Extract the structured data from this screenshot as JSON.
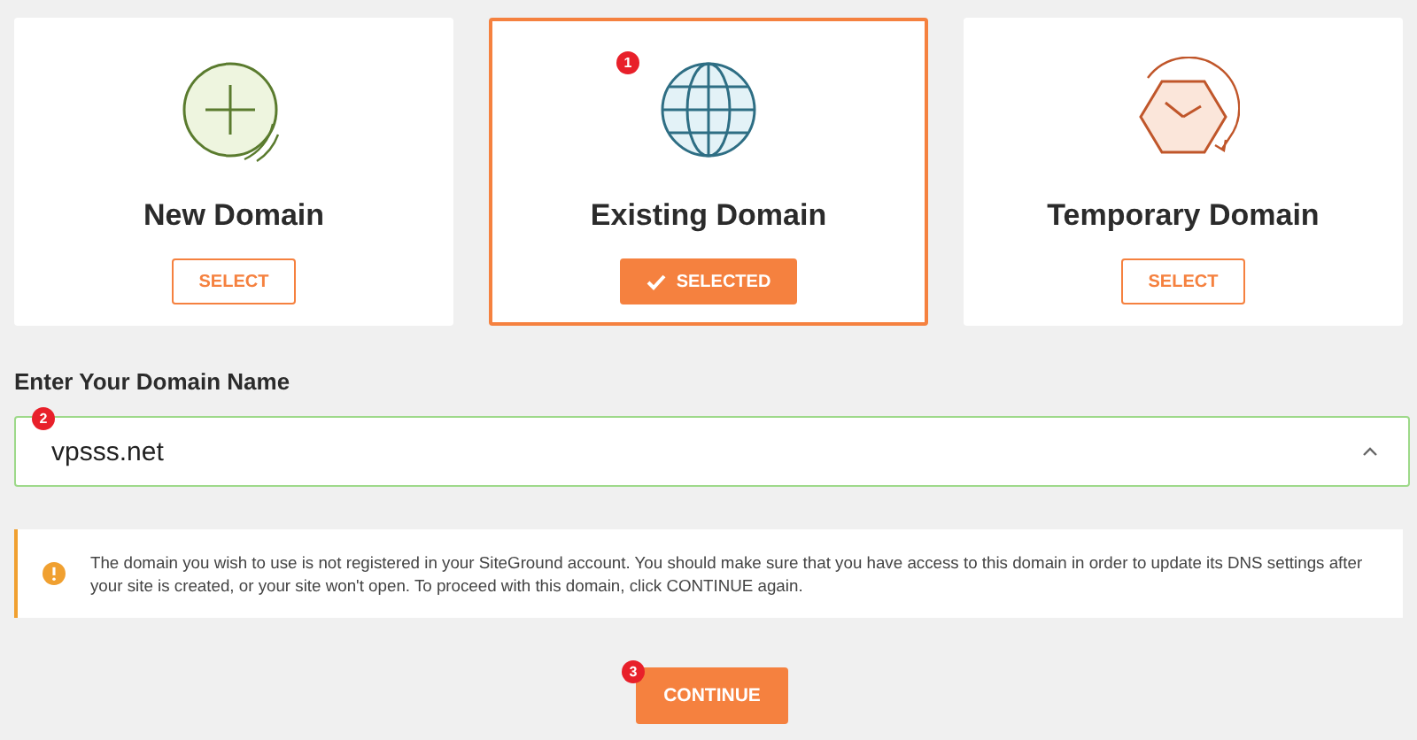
{
  "cards": [
    {
      "kind": "plus",
      "title": "New Domain",
      "button": "SELECT",
      "selected": false
    },
    {
      "kind": "globe",
      "title": "Existing Domain",
      "button": "SELECTED",
      "selected": true,
      "marker": "1"
    },
    {
      "kind": "clock",
      "title": "Temporary Domain",
      "button": "SELECT",
      "selected": false
    }
  ],
  "domain_field": {
    "label": "Enter Your Domain Name",
    "value": "vpsss.net",
    "marker": "2"
  },
  "alert": {
    "kind": "warning",
    "message": "The domain you wish to use is not registered in your SiteGround account. You should make sure that you have access to this domain in order to update its DNS settings after your site is created, or your site won't open. To proceed with this domain, click CONTINUE again."
  },
  "continue_button": {
    "label": "CONTINUE",
    "marker": "3"
  }
}
